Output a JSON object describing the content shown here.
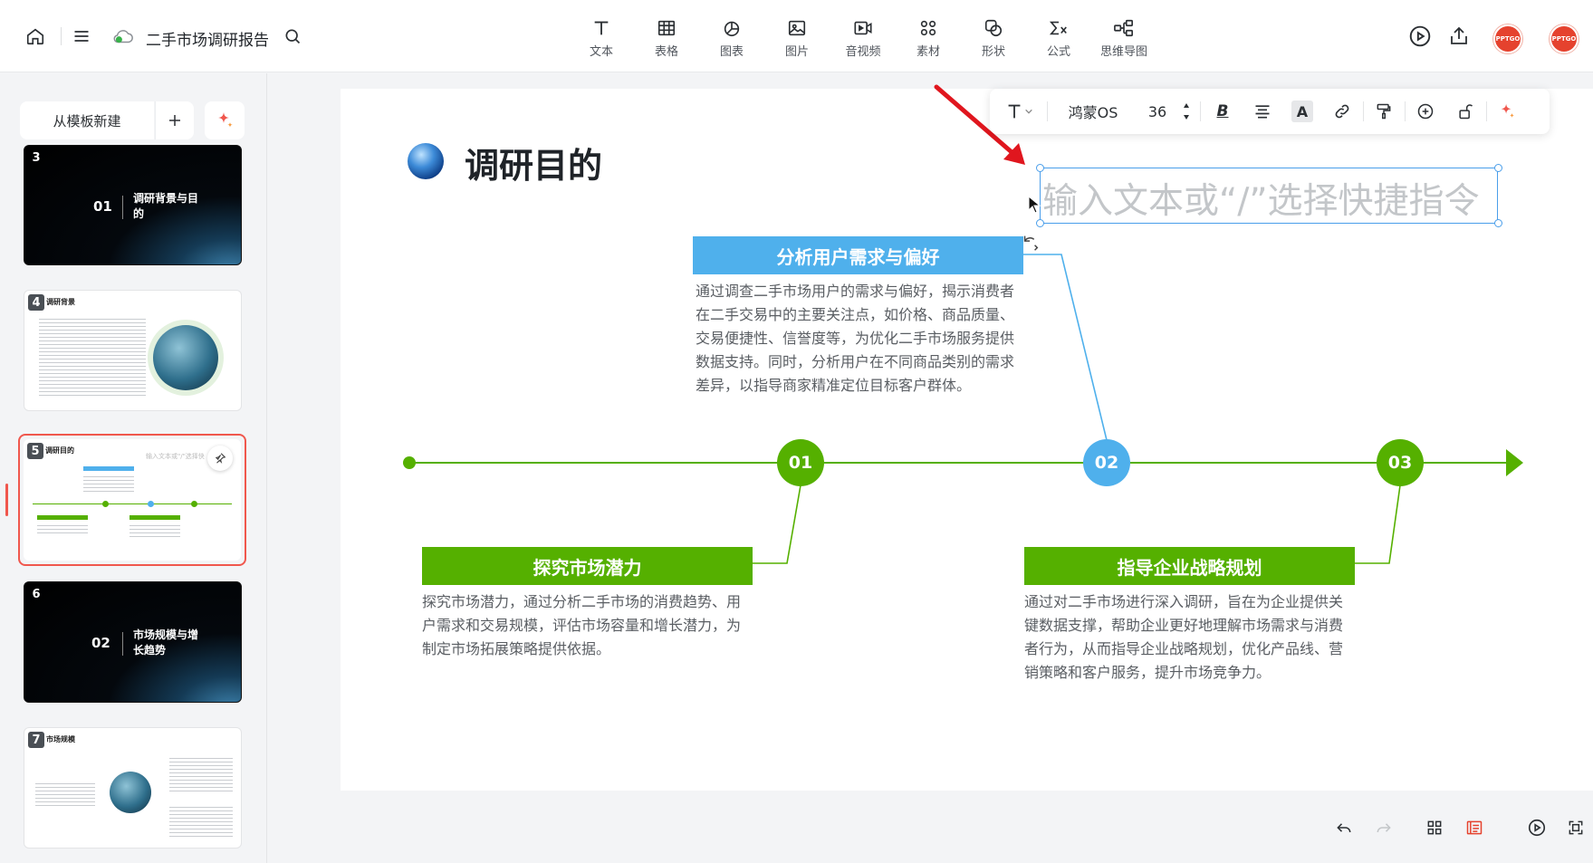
{
  "header": {
    "doc_title": "二手市场调研报告",
    "tools": [
      {
        "label": "文本",
        "icon": "text-icon"
      },
      {
        "label": "表格",
        "icon": "table-icon"
      },
      {
        "label": "图表",
        "icon": "chart-icon"
      },
      {
        "label": "图片",
        "icon": "image-icon"
      },
      {
        "label": "音视频",
        "icon": "video-icon"
      },
      {
        "label": "素材",
        "icon": "material-icon"
      },
      {
        "label": "形状",
        "icon": "shape-icon"
      },
      {
        "label": "公式",
        "icon": "formula-icon"
      },
      {
        "label": "思维导图",
        "icon": "mindmap-icon"
      }
    ],
    "avatar_label": "PPTGO"
  },
  "sidebar": {
    "new_from_template": "从模板新建",
    "thumbnails": [
      {
        "num": "3",
        "index_text": "01",
        "title": "调研背景与目的",
        "dark": true
      },
      {
        "num": "4",
        "title": "调研背景",
        "dark": false
      },
      {
        "num": "5",
        "title": "调研目的",
        "placeholder": "输入文本或\"/\"选择快",
        "dark": false,
        "selected": true
      },
      {
        "num": "6",
        "index_text": "02",
        "title": "市场规模与增长趋势",
        "dark": true
      },
      {
        "num": "7",
        "title": "市场规模",
        "dark": false
      }
    ]
  },
  "format_toolbar": {
    "font": "鸿蒙OS",
    "size": "36",
    "bold": "B",
    "color_letter": "A"
  },
  "slide": {
    "title": "调研目的",
    "placeholder": "输入文本或“/”选择快捷指令",
    "items": [
      {
        "number": "01",
        "heading": "探究市场潜力",
        "text": "探究市场潜力，通过分析二手市场的消费趋势、用户需求和交易规模，评估市场容量和增长潜力，为制定市场拓展策略提供依据。",
        "color": "#55b000"
      },
      {
        "number": "02",
        "heading": "分析用户需求与偏好",
        "text": "通过调查二手市场用户的需求与偏好，揭示消费者在二手交易中的主要关注点，如价格、商品质量、交易便捷性、信誉度等，为优化二手市场服务提供数据支持。同时，分析用户在不同商品类别的需求差异，以指导商家精准定位目标客户群体。",
        "color": "#4fb0ec"
      },
      {
        "number": "03",
        "heading": "指导企业战略规划",
        "text": "通过对二手市场进行深入调研，旨在为企业提供关键数据支撑，帮助企业更好地理解市场需求与消费者行为，从而指导企业战略规划，优化产品线、营销策略和客户服务，提升市场竞争力。",
        "color": "#55b000"
      }
    ]
  }
}
